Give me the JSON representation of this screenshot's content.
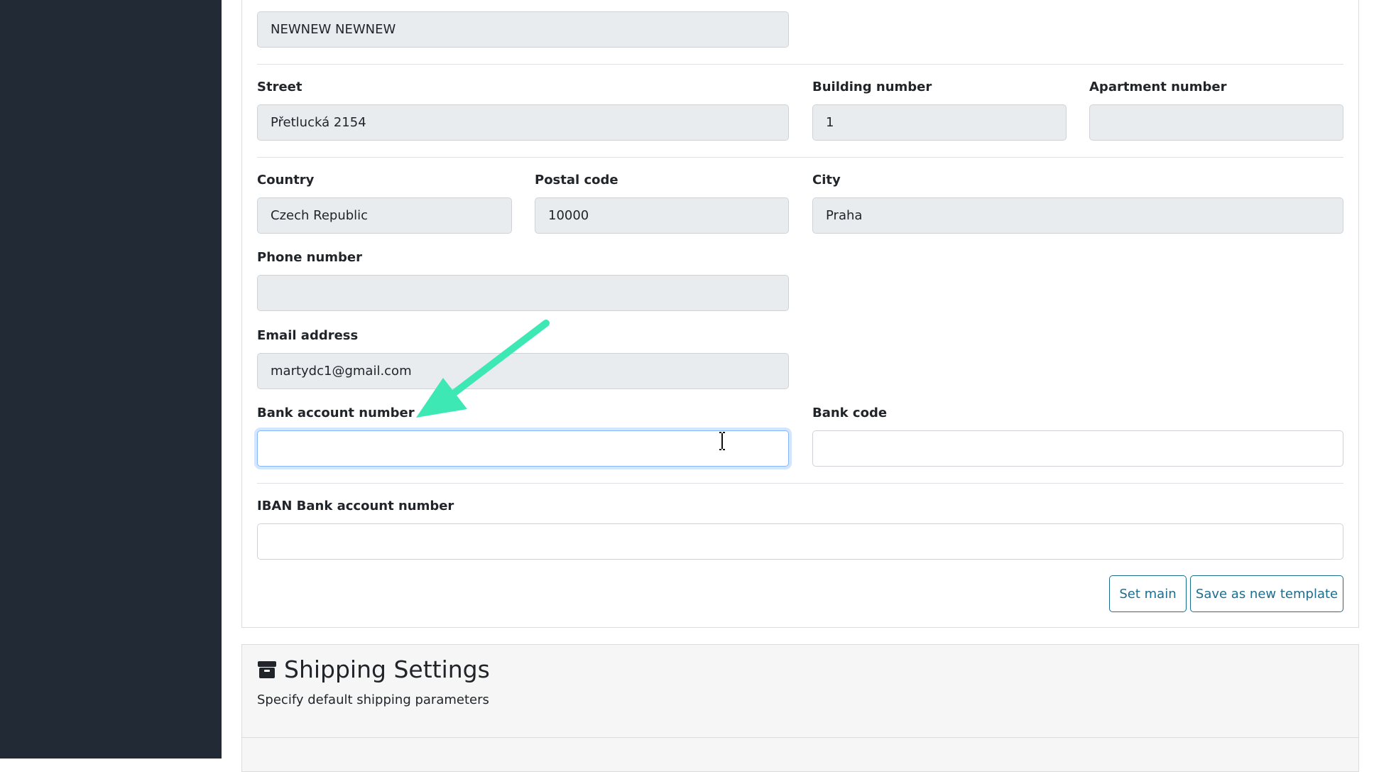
{
  "form": {
    "name_value": "NEWNEW NEWNEW",
    "street_label": "Street",
    "street_value": "Přetlucká 2154",
    "building_label": "Building number",
    "building_value": "1",
    "apartment_label": "Apartment number",
    "apartment_value": "",
    "country_label": "Country",
    "country_value": "Czech Republic",
    "postal_label": "Postal code",
    "postal_value": "10000",
    "city_label": "City",
    "city_value": "Praha",
    "phone_label": "Phone number",
    "phone_value": "",
    "email_label": "Email address",
    "email_value": "martydc1@gmail.com",
    "bank_account_label": "Bank account number",
    "bank_account_value": "",
    "bank_code_label": "Bank code",
    "bank_code_value": "",
    "iban_label": "IBAN Bank account number",
    "iban_value": ""
  },
  "actions": {
    "set_main_label": "Set main",
    "save_template_label": "Save as new template"
  },
  "shipping": {
    "title": "Shipping Settings",
    "subtitle": "Specify default shipping parameters",
    "icon": "box-icon"
  },
  "colors": {
    "sidebar": "#222a35",
    "accent": "#1b6e8f",
    "annotation_arrow": "#3ee8b5"
  }
}
